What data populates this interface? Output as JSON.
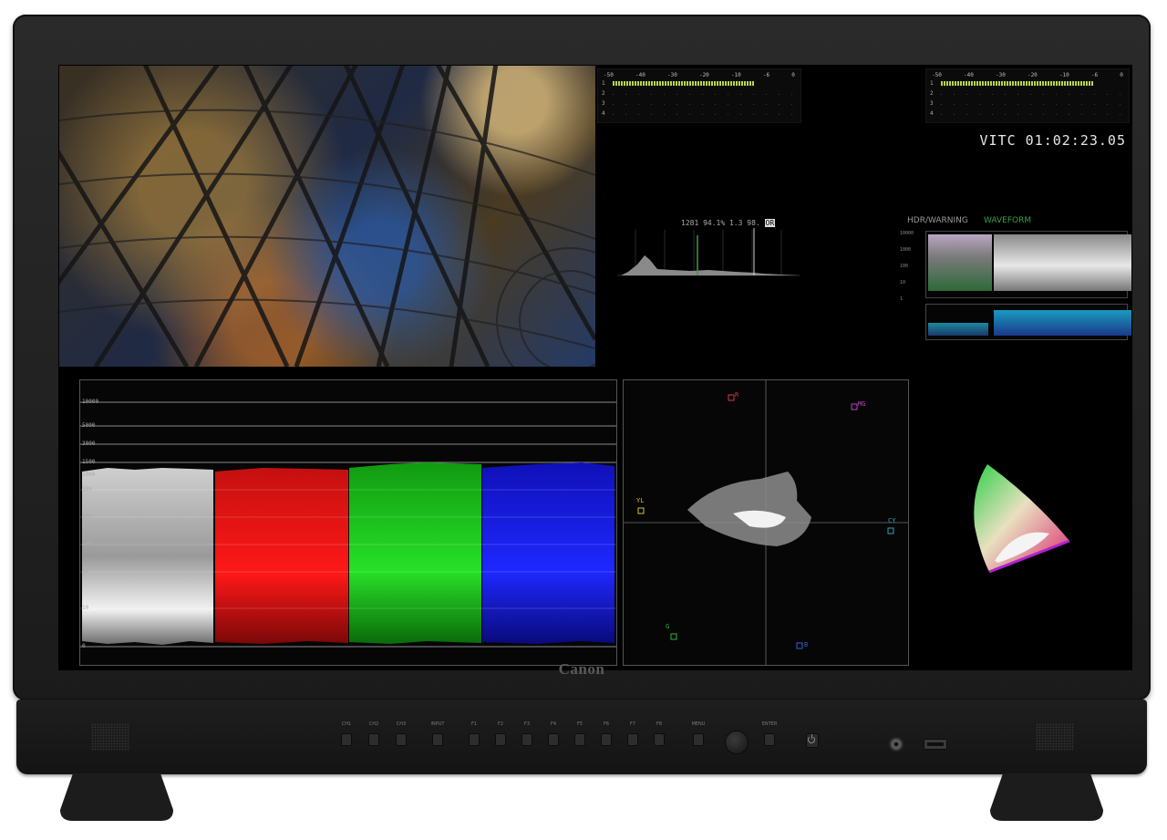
{
  "device": {
    "brand": "Canon"
  },
  "screen": {
    "timecode": "VITC  01:02:23.05",
    "audio_meters": [
      {
        "scale": [
          "-50",
          "-40",
          "-30",
          "-20",
          "-10",
          "-6",
          "0"
        ],
        "channels": [
          "1",
          "2",
          "3",
          "4"
        ],
        "level_fraction": 0.78
      },
      {
        "scale": [
          "-50",
          "-40",
          "-30",
          "-20",
          "-10",
          "-6",
          "0"
        ],
        "channels": [
          "1",
          "2",
          "3",
          "4"
        ],
        "level_fraction": 0.84
      }
    ],
    "histogram": {
      "title": "1281 94.1% 1.3 98.",
      "title_highlight": "OR"
    },
    "false_color": {
      "title_left": "HDR/WARNING",
      "title_right": "WAVEFORM",
      "scale": [
        "10000",
        "1000",
        "100",
        "10",
        "1"
      ]
    },
    "waveform": {
      "scale": [
        "10000",
        "5000",
        "3000",
        "1500",
        "1000",
        "500",
        "300",
        "100",
        "50",
        "10",
        "5",
        "0"
      ]
    },
    "vectorscope": {
      "targets": [
        {
          "label": "R",
          "color": "#d23a3a"
        },
        {
          "label": "MG",
          "color": "#c040c0"
        },
        {
          "label": "YL",
          "color": "#d0c030"
        },
        {
          "label": "CY",
          "color": "#30a0c0"
        },
        {
          "label": "G",
          "color": "#30b040"
        },
        {
          "label": "B",
          "color": "#3060d0"
        }
      ]
    }
  },
  "controls": {
    "buttons": [
      "CH1",
      "CH2",
      "CH3",
      "INPUT",
      "F1",
      "F2",
      "F3",
      "F4",
      "F5",
      "F6",
      "F7",
      "F8",
      "MENU",
      "ENTER"
    ],
    "colors": {
      "bezel": "#1f1f1f",
      "screen": "#000000",
      "audio_bar": "#b9d54a"
    }
  }
}
